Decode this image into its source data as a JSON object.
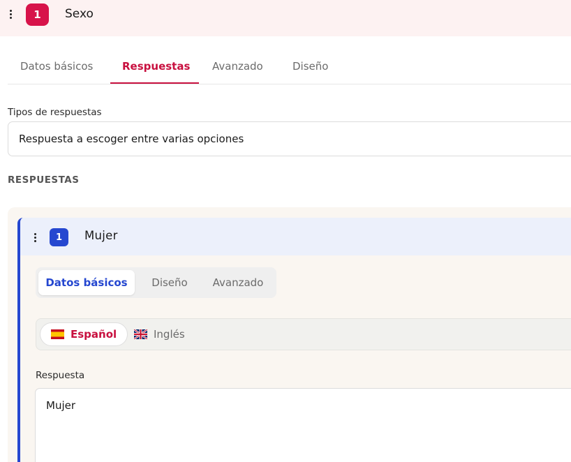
{
  "question": {
    "number": "1",
    "title": "Sexo"
  },
  "tabs": [
    {
      "label": "Datos básicos"
    },
    {
      "label": "Respuestas"
    },
    {
      "label": "Avanzado"
    },
    {
      "label": "Diseño"
    }
  ],
  "response_type": {
    "label": "Tipos de respuestas",
    "value": "Respuesta a escoger entre varias opciones"
  },
  "answers_section": {
    "title": "RESPUESTAS"
  },
  "answer": {
    "number": "1",
    "title": "Mujer",
    "tabs": [
      {
        "label": "Datos básicos"
      },
      {
        "label": "Diseño"
      },
      {
        "label": "Avanzado"
      }
    ],
    "languages": [
      {
        "label": "Español",
        "flag": "spain-flag-icon"
      },
      {
        "label": "Inglés",
        "flag": "uk-flag-icon"
      }
    ],
    "field_label": "Respuesta",
    "field_value": "Mujer"
  },
  "colors": {
    "primary": "#c8103f",
    "accent_blue": "#2547d0",
    "header_bg": "#fdf2f2"
  }
}
